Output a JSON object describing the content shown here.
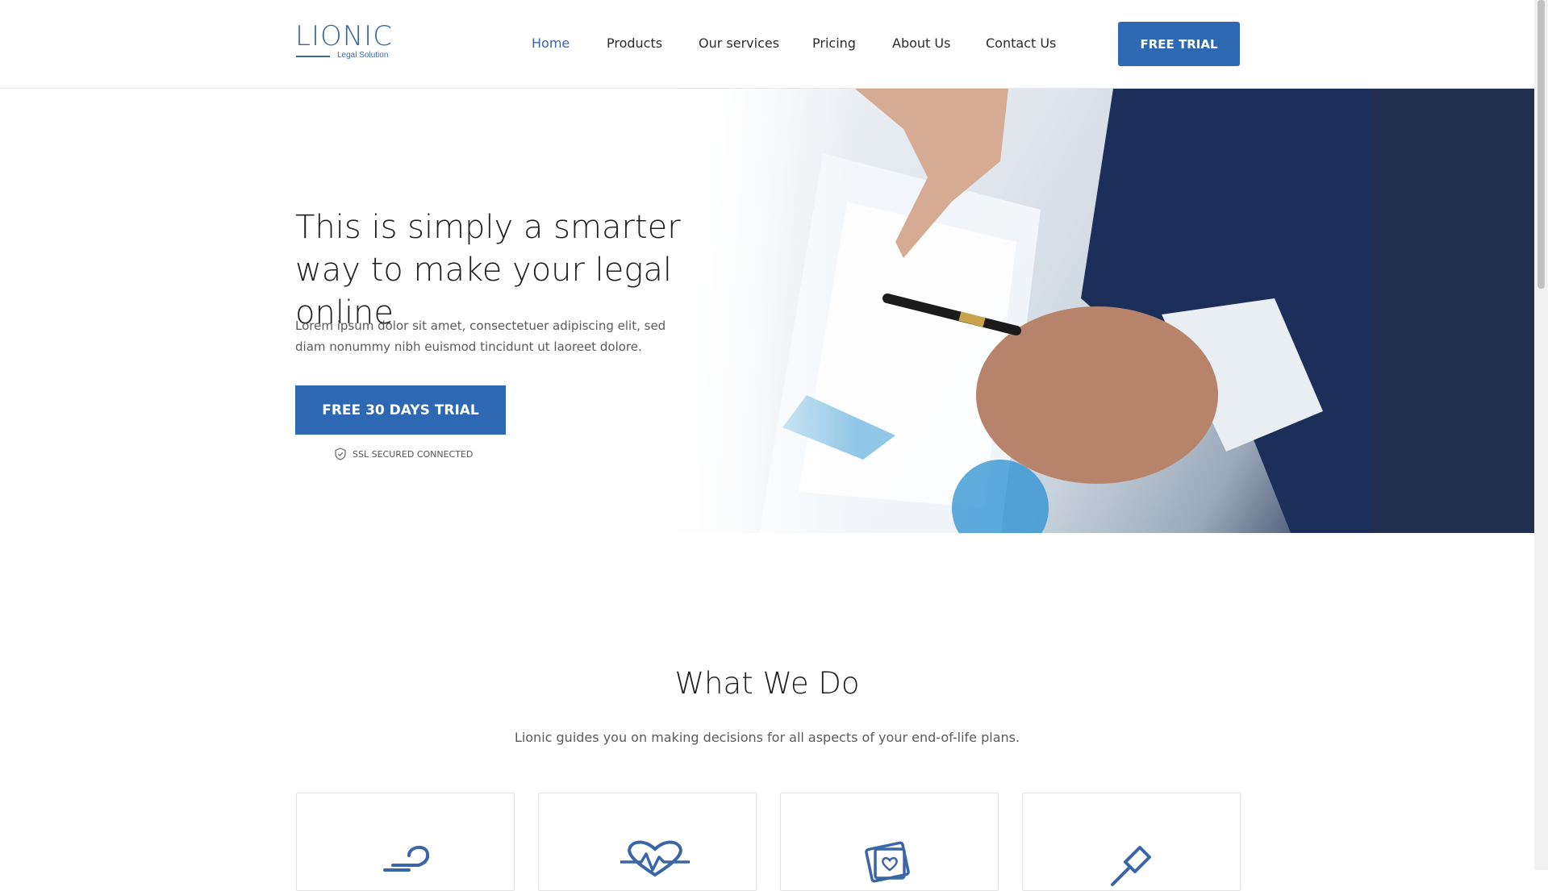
{
  "brand": {
    "name": "LIONIC",
    "tagline": "Legal Solution"
  },
  "nav": {
    "items": [
      {
        "label": "Home",
        "active": true
      },
      {
        "label": "Products"
      },
      {
        "label": "Our services"
      },
      {
        "label": "Pricing"
      },
      {
        "label": "About Us"
      },
      {
        "label": "Contact Us"
      }
    ],
    "cta_label": "FREE TRIAL"
  },
  "hero": {
    "title": "This is simply a smarter way to make your legal online",
    "text": "Lorem ipsum dolor sit amet, consectetuer adipiscing elit, sed diam nonummy nibh euismod tincidunt ut laoreet dolore.",
    "cta_label": "FREE 30 DAYS TRIAL",
    "ssl_text": "SSL SECURED CONNECTED"
  },
  "what_we_do": {
    "title": "What We Do",
    "subtitle": "Lionic guides you on making decisions for all aspects of your end-of-life plans.",
    "cards": [
      {
        "icon": "hand-care-icon"
      },
      {
        "icon": "heartbeat-icon"
      },
      {
        "icon": "money-cards-icon"
      },
      {
        "icon": "gavel-icon"
      }
    ]
  },
  "colors": {
    "accent": "#2f68b2",
    "brand": "#3a66a8"
  }
}
